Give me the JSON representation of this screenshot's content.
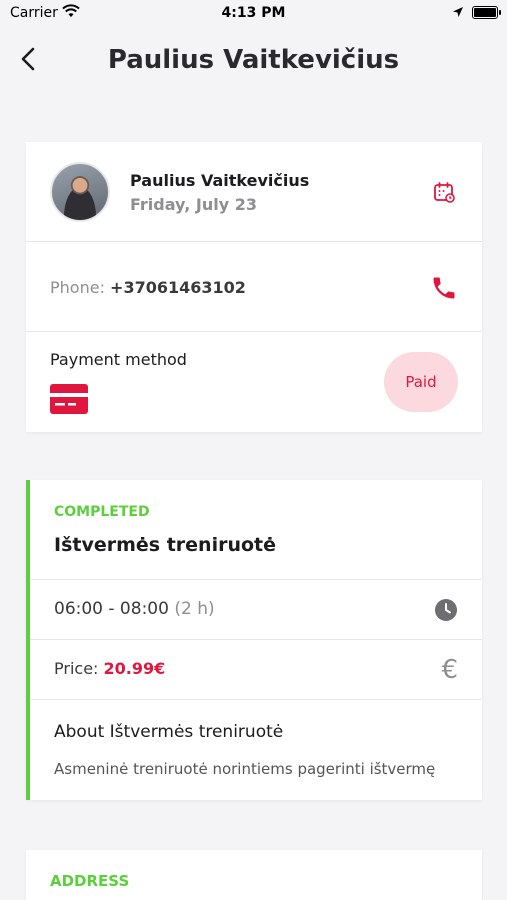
{
  "status_bar": {
    "carrier": "Carrier",
    "time": "4:13 PM"
  },
  "nav": {
    "title": "Paulius Vaitkevičius"
  },
  "client": {
    "name": "Paulius Vaitkevičius",
    "date": "Friday, July 23",
    "phone_label": "Phone:",
    "phone": "+37061463102",
    "payment_label": "Payment method",
    "payment_status": "Paid"
  },
  "session": {
    "status": "COMPLETED",
    "title": "Ištvermės treniruotė",
    "time": "06:00 - 08:00",
    "duration": "(2 h)",
    "price_label": "Price:",
    "price": "20.99€",
    "about_title": "About Ištvermės treniruotė",
    "about_desc": "Asmeninė treniruotė norintiems pagerinti ištvermę"
  },
  "address": {
    "label": "ADDRESS"
  },
  "colors": {
    "accent_red": "#e0163f",
    "accent_green": "#5ccf3e",
    "background": "#f4f4f6",
    "badge_bg": "#fcd9de"
  },
  "icons": [
    "wifi-icon",
    "location-arrow-icon",
    "battery-icon",
    "back-chevron-icon",
    "calendar-icon",
    "phone-icon",
    "credit-card-icon",
    "clock-icon",
    "euro-icon"
  ]
}
